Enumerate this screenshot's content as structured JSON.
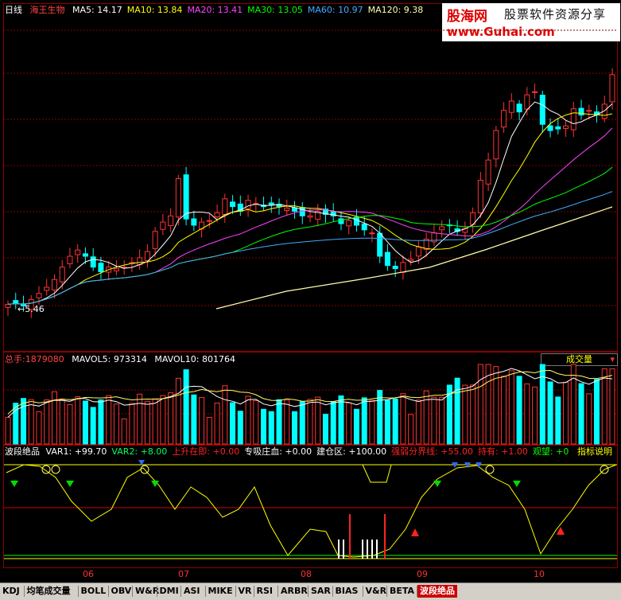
{
  "price_panel": {
    "period_label": "日线",
    "stock_name": "海王生物",
    "ma": [
      {
        "label": "MA5: 14.17",
        "color": "#ffffff"
      },
      {
        "label": "MA10: 13.84",
        "color": "#ffff00"
      },
      {
        "label": "MA20: 13.41",
        "color": "#ff44ff"
      },
      {
        "label": "MA30: 13.05",
        "color": "#00ff00"
      },
      {
        "label": "MA60: 10.97",
        "color": "#44aaff"
      },
      {
        "label": "MA120: 9.38",
        "color": "#ffffaa"
      }
    ],
    "low_marker": "5.46"
  },
  "logo": {
    "name_red": "股海网",
    "name_black": "股票软件资源分享",
    "url": "www.Guhai.com"
  },
  "volume_panel": {
    "total": {
      "label": "总手:",
      "value": "1879080"
    },
    "mavol5": "MAVOL5: 973314",
    "mavol10": "MAVOL10: 801764",
    "selector": "成交量"
  },
  "indicator_panel": {
    "name": "波段绝品",
    "items": [
      {
        "text": "VAR1: +99.70",
        "color": "#ffffff"
      },
      {
        "text": "VAR2: +8.00",
        "color": "#00ff66"
      },
      {
        "text": "上升在即: +0.00",
        "color": "#ff2222"
      },
      {
        "text": "专吸庄血: +0.00",
        "color": "#ffffff"
      },
      {
        "text": "建仓区: +100.00",
        "color": "#ffffff"
      },
      {
        "text": "强弱分界线: +55.00",
        "color": "#ff2222"
      },
      {
        "text": "持有: +1.00",
        "color": "#ff2222"
      },
      {
        "text": "观望: +0",
        "color": "#00ff00"
      }
    ],
    "help": "指标说明"
  },
  "months": [
    "06",
    "07",
    "08",
    "09",
    "10"
  ],
  "tabs": [
    "KDJ",
    "均笔成交量",
    "BOLL",
    "OBV",
    "W&R",
    "DMI",
    "ASI",
    "MIKE",
    "VR",
    "RSI",
    "ARBR",
    "SAR",
    "BIAS",
    "V&R",
    "BETA",
    "波段绝品"
  ],
  "active_tab": "波段绝品",
  "colors": {
    "up": "#ff3333",
    "down": "#00ffff",
    "grid": "#8a0000"
  },
  "chart_data": {
    "type": "candlestick",
    "close": [
      5.9,
      6.0,
      5.8,
      6.2,
      6.6,
      7.0,
      7.5,
      8.3,
      9.0,
      9.4,
      9.0,
      8.3,
      8.0,
      8.3,
      8.2,
      8.3,
      8.6,
      8.9,
      9.3,
      10.6,
      11.2,
      11.6,
      14.0,
      11.4,
      11.0,
      11.2,
      11.3,
      11.8,
      12.7,
      12.2,
      11.9,
      12.6,
      12.4,
      12.2,
      12.3,
      12.2,
      12.1,
      11.9,
      11.6,
      11.6,
      11.9,
      11.7,
      11.6,
      11.1,
      11.3,
      11.0,
      10.7,
      10.5,
      9.0,
      8.4,
      8.2,
      8.6,
      8.8,
      9.6,
      10.1,
      10.5,
      10.9,
      11.0,
      10.6,
      10.8,
      11.8,
      13.9,
      15.2,
      17.1,
      18.4,
      19.0,
      18.3,
      19.4,
      19.6,
      17.5,
      17.1,
      17.2,
      17.4,
      18.5,
      18.1,
      18.4,
      18.1,
      18.8,
      20.7
    ]
  }
}
